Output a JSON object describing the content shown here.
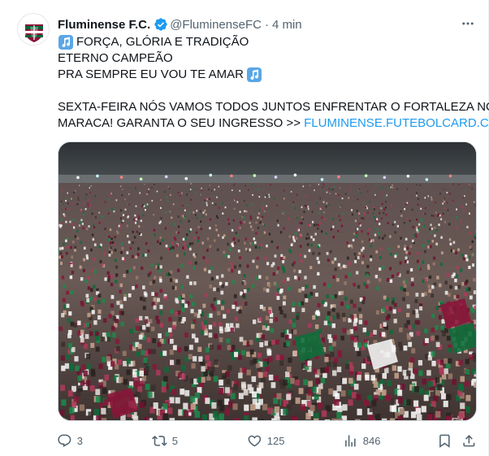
{
  "tweet": {
    "author": {
      "display_name": "Fluminense F.C.",
      "handle": "@FluminenseFC",
      "time": "4 min",
      "verified": true,
      "avatar": "fluminense-crest"
    },
    "text": {
      "line1": "FORÇA, GLÓRIA E TRADIÇÃO",
      "line2": "ETERNO CAMPEÃO",
      "line3": "PRA SEMPRE EU VOU TE AMAR",
      "line4": "SEXTA-FEIRA NÓS VAMOS TODOS JUNTOS ENFRENTAR O FORTALEZA NO",
      "line5": "MARACA! GARANTA O SEU INGRESSO >>",
      "link": "FLUMINENSE.FUTEBOLCARD.COM",
      "note_emoji": "musical-note-icon"
    },
    "media": {
      "description_icon": "stadium-crowd-photo"
    },
    "actions": {
      "replies": "3",
      "reposts": "5",
      "likes": "125",
      "views": "846"
    },
    "colors": {
      "accent": "#1d9bf0",
      "muted": "#536471",
      "text": "#0f1419",
      "club_maroon": "#8a1538",
      "club_green": "#006437"
    }
  }
}
